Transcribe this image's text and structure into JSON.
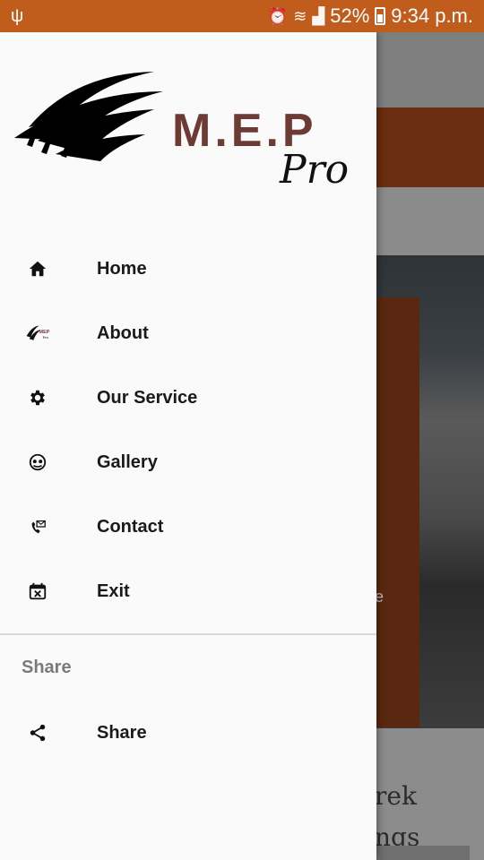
{
  "status_bar": {
    "battery_pct": "52%",
    "time": "9:34 p.m.",
    "colors": {
      "background": "#c05c1c"
    }
  },
  "logo": {
    "brand": "M.E.P",
    "sub": "Pro"
  },
  "menu": {
    "items": [
      {
        "label": "Home",
        "icon": "home-icon"
      },
      {
        "label": "About",
        "icon": "mep-logo-icon"
      },
      {
        "label": "Our Service",
        "icon": "gear-icon"
      },
      {
        "label": "Gallery",
        "icon": "gallery-icon"
      },
      {
        "label": "Contact",
        "icon": "phone-mail-icon"
      },
      {
        "label": "Exit",
        "icon": "calendar-x-icon"
      }
    ]
  },
  "share_section": {
    "header": "Share",
    "items": [
      {
        "label": "Share",
        "icon": "share-icon"
      }
    ]
  },
  "background_app": {
    "photo_caption": "e",
    "title_line1": "rek",
    "title_line2": "ngs"
  }
}
